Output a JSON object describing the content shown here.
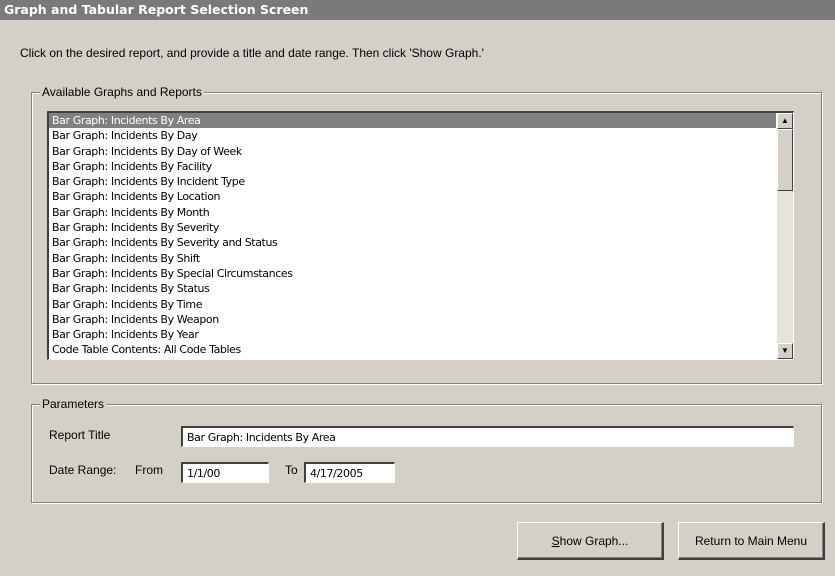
{
  "window": {
    "title": "Graph and Tabular Report Selection Screen"
  },
  "instructions": "Click on the desired report, and provide a title and date range.  Then click 'Show Graph.'",
  "reports_group": {
    "label": "Available Graphs and Reports",
    "items": [
      "Bar Graph: Incidents By Area",
      "Bar Graph: Incidents By Day",
      "Bar Graph: Incidents By Day of Week",
      "Bar Graph: Incidents By Facility",
      "Bar Graph: Incidents By Incident Type",
      "Bar Graph: Incidents By Location",
      "Bar Graph: Incidents By Month",
      "Bar Graph: Incidents By Severity",
      "Bar Graph: Incidents By Severity and Status",
      "Bar Graph: Incidents By Shift",
      "Bar Graph: Incidents By Special Circumstances",
      "Bar Graph: Incidents By Status",
      "Bar Graph: Incidents By Time",
      "Bar Graph: Incidents By Weapon",
      "Bar Graph: Incidents By Year",
      "Code Table Contents: All Code Tables"
    ],
    "selected_index": 0,
    "scroll_up_icon": "▲",
    "scroll_down_icon": "▼"
  },
  "parameters": {
    "label": "Parameters",
    "report_title_label": "Report Title",
    "report_title_value": "Bar Graph: Incidents By Area",
    "date_range_label": "Date Range:",
    "from_label": "From",
    "from_value": "1/1/00",
    "to_label": "To",
    "to_value": "4/17/2005"
  },
  "buttons": {
    "show_graph_mnemonic": "S",
    "show_graph_rest": "how Graph...",
    "return_label": "Return to Main Menu"
  }
}
